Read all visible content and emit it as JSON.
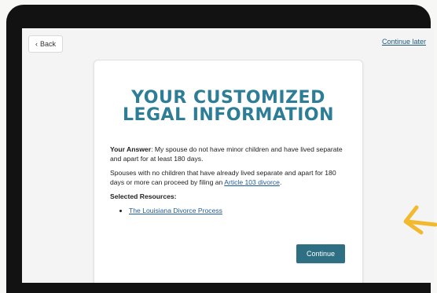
{
  "nav": {
    "back_label": "Back",
    "continue_later_label": "Continue later"
  },
  "card": {
    "title_line1": "YOUR CUSTOMIZED",
    "title_line2": "LEGAL INFORMATION",
    "answer_label": "Your Answer",
    "answer_text": ": My spouse do not have minor children and have lived separate and apart for at least 180 days.",
    "info_text": "Spouses with no children that have already lived separate and apart for 180 days or more can proceed by filing an ",
    "info_link": "Article 103 divorce",
    "info_end": ".",
    "resources_title": "Selected Resources:",
    "resources": [
      {
        "label": "The Louisiana Divorce Process"
      }
    ],
    "continue_label": "Continue"
  },
  "colors": {
    "accent": "#2e7d96",
    "button": "#2e6f84",
    "link": "#1f5a9a",
    "annotation_arrow": "#f2b82e"
  },
  "icons": {
    "back": "chevron-left-icon",
    "annotation": "arrow-pointer-icon"
  }
}
